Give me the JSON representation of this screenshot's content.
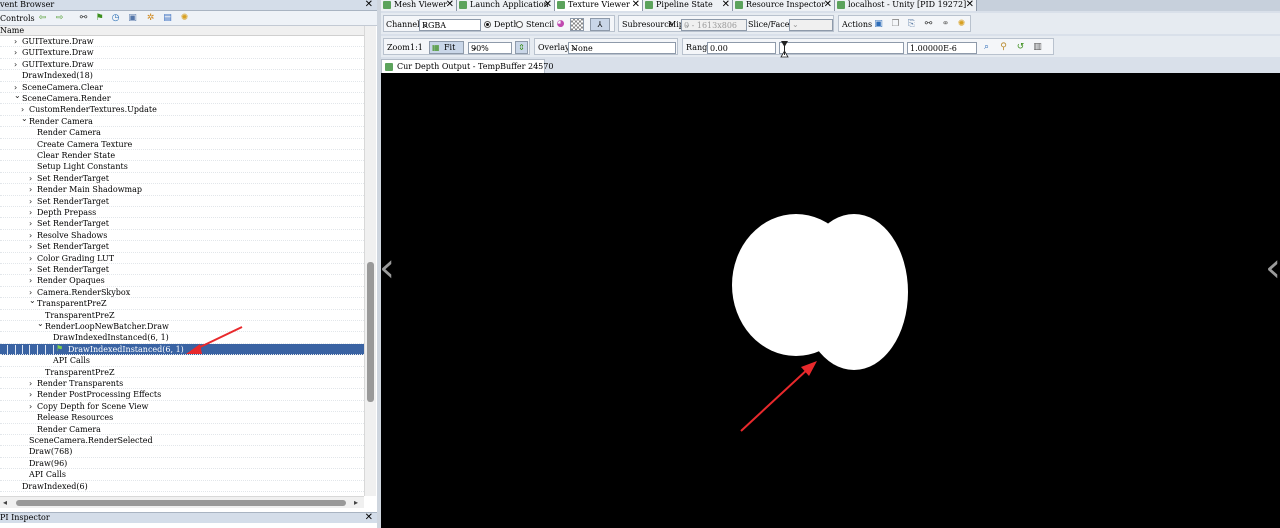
{
  "event_browser": {
    "title": "vent Browser",
    "controls_label": "Controls",
    "column_name": "Name",
    "toolbar_icons": [
      "arrow-left-icon",
      "arrow-right-icon",
      "binoculars-icon",
      "flag-icon",
      "clock-icon",
      "save-icon",
      "settings-icon",
      "gear-icon"
    ],
    "rows": [
      {
        "label": "GUITexture.Draw",
        "indent": 22,
        "arrow": "right"
      },
      {
        "label": "GUITexture.Draw",
        "indent": 22,
        "arrow": "right"
      },
      {
        "label": "GUITexture.Draw",
        "indent": 22,
        "arrow": "right"
      },
      {
        "label": "DrawIndexed(18)",
        "indent": 22,
        "arrow": ""
      },
      {
        "label": "SceneCamera.Clear",
        "indent": 22,
        "arrow": "right"
      },
      {
        "label": "SceneCamera.Render",
        "indent": 22,
        "arrow": "down"
      },
      {
        "label": "CustomRenderTextures.Update",
        "indent": 29,
        "arrow": "right"
      },
      {
        "label": "Render Camera",
        "indent": 29,
        "arrow": "down"
      },
      {
        "label": "Render Camera",
        "indent": 37,
        "arrow": ""
      },
      {
        "label": "Create Camera Texture",
        "indent": 37,
        "arrow": ""
      },
      {
        "label": "Clear Render State",
        "indent": 37,
        "arrow": ""
      },
      {
        "label": "Setup Light Constants",
        "indent": 37,
        "arrow": ""
      },
      {
        "label": "Set RenderTarget",
        "indent": 37,
        "arrow": "right"
      },
      {
        "label": "Render Main Shadowmap",
        "indent": 37,
        "arrow": "right"
      },
      {
        "label": "Set RenderTarget",
        "indent": 37,
        "arrow": "right"
      },
      {
        "label": "Depth Prepass",
        "indent": 37,
        "arrow": "right"
      },
      {
        "label": "Set RenderTarget",
        "indent": 37,
        "arrow": "right"
      },
      {
        "label": "Resolve Shadows",
        "indent": 37,
        "arrow": "right"
      },
      {
        "label": "Set RenderTarget",
        "indent": 37,
        "arrow": "right"
      },
      {
        "label": "Color Grading LUT",
        "indent": 37,
        "arrow": "right"
      },
      {
        "label": "Set RenderTarget",
        "indent": 37,
        "arrow": "right"
      },
      {
        "label": "Render Opaques",
        "indent": 37,
        "arrow": "right"
      },
      {
        "label": "Camera.RenderSkybox",
        "indent": 37,
        "arrow": "right"
      },
      {
        "label": "TransparentPreZ",
        "indent": 37,
        "arrow": "down"
      },
      {
        "label": "TransparentPreZ",
        "indent": 45,
        "arrow": ""
      },
      {
        "label": "RenderLoopNewBatcher.Draw",
        "indent": 45,
        "arrow": "down"
      },
      {
        "label": "DrawIndexedInstanced(6, 1)",
        "indent": 53,
        "arrow": ""
      },
      {
        "label": "DrawIndexedInstanced(6, 1)",
        "indent": 68,
        "arrow": "",
        "selected": true
      },
      {
        "label": "API Calls",
        "indent": 53,
        "arrow": ""
      },
      {
        "label": "TransparentPreZ",
        "indent": 45,
        "arrow": ""
      },
      {
        "label": "Render Transparents",
        "indent": 37,
        "arrow": "right"
      },
      {
        "label": "Render PostProcessing Effects",
        "indent": 37,
        "arrow": "right"
      },
      {
        "label": "Copy Depth for Scene View",
        "indent": 37,
        "arrow": "right"
      },
      {
        "label": "Release Resources",
        "indent": 37,
        "arrow": ""
      },
      {
        "label": "Render Camera",
        "indent": 37,
        "arrow": ""
      },
      {
        "label": "SceneCamera.RenderSelected",
        "indent": 29,
        "arrow": ""
      },
      {
        "label": "Draw(768)",
        "indent": 29,
        "arrow": ""
      },
      {
        "label": "Draw(96)",
        "indent": 29,
        "arrow": ""
      },
      {
        "label": "API Calls",
        "indent": 29,
        "arrow": ""
      },
      {
        "label": "DrawIndexed(6)",
        "indent": 22,
        "arrow": ""
      }
    ]
  },
  "api_inspector": {
    "title": "PI Inspector"
  },
  "tabs": [
    {
      "label": "Mesh Viewer"
    },
    {
      "label": "Launch Application"
    },
    {
      "label": "Texture Viewer",
      "active": true
    },
    {
      "label": "Pipeline State"
    },
    {
      "label": "Resource Inspector"
    },
    {
      "label": "localhost - Unity [PID 19272]"
    }
  ],
  "toolbar1": {
    "channels_label": "Channels",
    "channels_value": "RGBA",
    "depth_label": "Depth",
    "stencil_label": "Stencil",
    "subresource_label": "Subresource",
    "mip_label": "Mip",
    "mip_value": "0 - 1613x806",
    "slice_label": "Slice/Face",
    "actions_label": "Actions"
  },
  "toolbar2": {
    "zoom_label": "Zoom",
    "zoom_ratio": "1:1",
    "fit_label": "Fit",
    "zoom_value": "90%",
    "overlay_label": "Overlay",
    "overlay_value": "None",
    "range_label": "Range",
    "range_min": "0.00",
    "range_max": "1.00000E-6"
  },
  "doc_tab": {
    "label": "Cur Depth Output - TempBuffer 24570"
  },
  "texture": {
    "background": "#000000",
    "shape_color": "#ffffff"
  },
  "colors": {
    "selection": "#3a63a3",
    "annotation": "#e8292c",
    "tab_icon": "#5ca35c"
  }
}
